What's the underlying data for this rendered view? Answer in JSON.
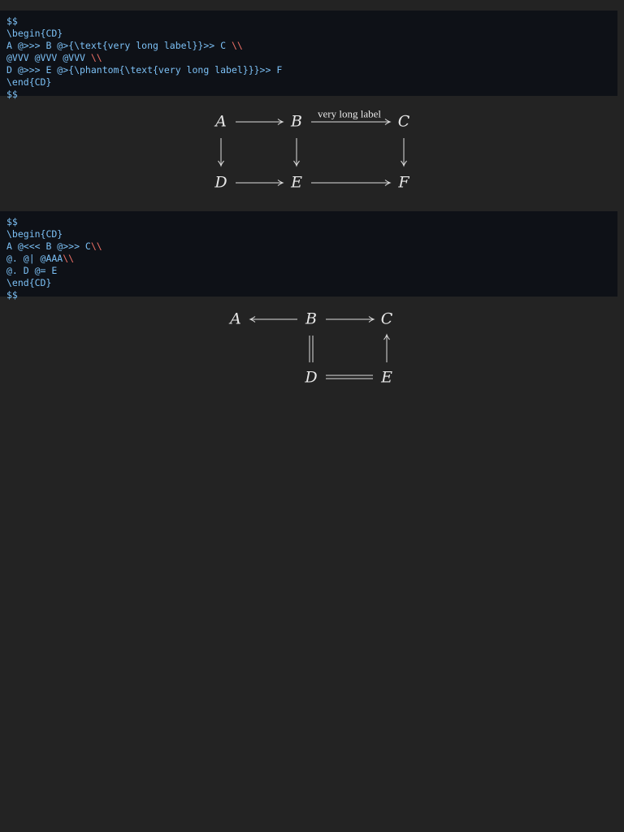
{
  "code_blocks": [
    {
      "lines": [
        [
          {
            "t": "$$"
          }
        ],
        [
          {
            "t": "\\begin{CD}"
          }
        ],
        [
          {
            "t": "A @>>> B @>{\\text{very long label}}>> C "
          },
          {
            "t": "\\\\",
            "esc": true
          }
        ],
        [
          {
            "t": "@VVV @VVV @VVV "
          },
          {
            "t": "\\\\",
            "esc": true
          }
        ],
        [
          {
            "t": "D @>>> E @>{\\phantom{\\text{very long label}}}>> F"
          }
        ],
        [
          {
            "t": "\\end{CD}"
          }
        ],
        [
          {
            "t": "$$"
          }
        ]
      ]
    },
    {
      "lines": [
        [
          {
            "t": "$$"
          }
        ],
        [
          {
            "t": "\\begin{CD}"
          }
        ],
        [
          {
            "t": "A @<<< B @>>> C"
          },
          {
            "t": "\\\\",
            "esc": true
          }
        ],
        [
          {
            "t": "@. @| @AAA"
          },
          {
            "t": "\\\\",
            "esc": true
          }
        ],
        [
          {
            "t": "@. D @= E"
          }
        ],
        [
          {
            "t": "\\end{CD}"
          }
        ],
        [
          {
            "t": "$$"
          }
        ]
      ]
    }
  ],
  "diagram1": {
    "nodes": {
      "A": "A",
      "B": "B",
      "C": "C",
      "D": "D",
      "E": "E",
      "F": "F"
    },
    "label_bc": "very long label"
  },
  "diagram2": {
    "nodes": {
      "A": "A",
      "B": "B",
      "C": "C",
      "D": "D",
      "E": "E"
    }
  }
}
